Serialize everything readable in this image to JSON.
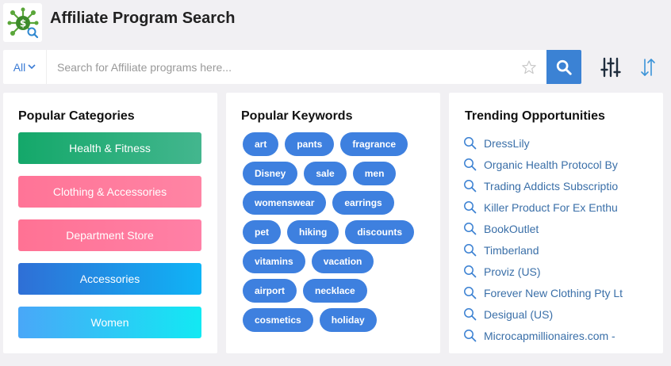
{
  "app": {
    "title": "Affiliate Program Search"
  },
  "search": {
    "scope_label": "All",
    "placeholder": "Search for Affiliate programs here..."
  },
  "categories": {
    "title": "Popular Categories",
    "items": [
      {
        "label": "Health & Fitness"
      },
      {
        "label": "Clothing & Accessories"
      },
      {
        "label": "Department Store"
      },
      {
        "label": "Accessories"
      },
      {
        "label": "Women"
      }
    ]
  },
  "keywords": {
    "title": "Popular Keywords",
    "items": [
      "art",
      "pants",
      "fragrance",
      "Disney",
      "sale",
      "men",
      "womenswear",
      "earrings",
      "pet",
      "hiking",
      "discounts",
      "vitamins",
      "vacation",
      "airport",
      "necklace",
      "cosmetics",
      "holiday"
    ]
  },
  "trending": {
    "title": "Trending Opportunities",
    "items": [
      "DressLily",
      "Organic Health Protocol By",
      "Trading Addicts Subscriptio",
      "Killer Product For Ex Enthu",
      "BookOutlet",
      "Timberland",
      "Proviz (US)",
      "Forever New Clothing Pty Lt",
      "Desigual (US)",
      "Microcapmillionaires.com -"
    ]
  },
  "colors": {
    "accent": "#3b82d4",
    "chip": "#3e80df",
    "link": "#3a6fa8",
    "logo_green": "#4caf50"
  },
  "icons": {
    "logo": "dollar-network-icon",
    "star": "star-icon",
    "search": "search-icon",
    "filter": "sliders-icon",
    "sort": "sort-arrows-icon",
    "trend": "search-icon"
  }
}
